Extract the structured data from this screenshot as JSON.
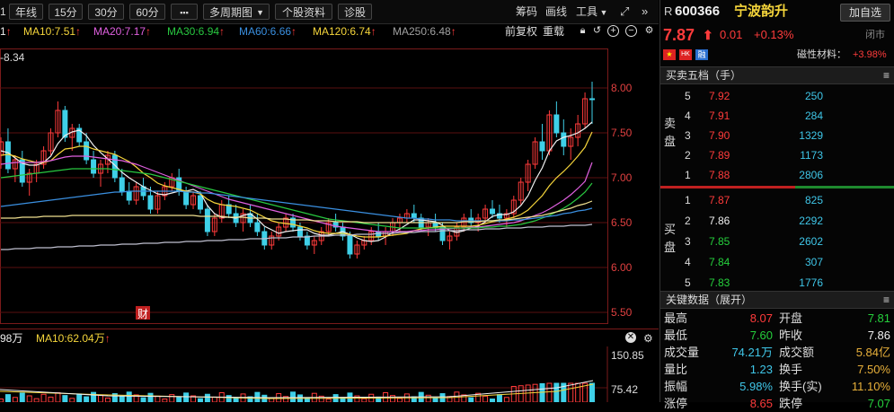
{
  "toolbar": {
    "first": "1",
    "year_line": "年线",
    "min15": "15分",
    "min30": "30分",
    "min60": "60分",
    "more": "▪▪▪",
    "multi_period": "多周期图",
    "stock_info": "个股资料",
    "diagnose": "诊股",
    "chips": "筹码",
    "draw_line": "画线",
    "tools": "工具"
  },
  "ma": {
    "ma5": "1",
    "ma10": "MA10:7.51",
    "ma20": "MA20:7.17",
    "ma30": "MA30:6.94",
    "ma60": "MA60:6.66",
    "ma120": "MA120:6.74",
    "ma250": "MA250:6.48",
    "arrow": "↑",
    "adjust": "前复权",
    "overlay": "重载"
  },
  "chart_data": {
    "type": "candlestick",
    "yticks": [
      "8.00",
      "7.50",
      "7.00",
      "6.50",
      "6.00",
      "5.50"
    ],
    "ylim": [
      5.5,
      8.34
    ],
    "top_label": "8.34",
    "annotation": "财",
    "candles": [
      [
        7.25,
        7.45,
        7.1,
        7.4
      ],
      [
        7.4,
        7.55,
        7.05,
        7.1
      ],
      [
        7.1,
        7.25,
        6.95,
        7.2
      ],
      [
        7.2,
        7.3,
        6.9,
        6.95
      ],
      [
        6.95,
        7.1,
        6.8,
        7.05
      ],
      [
        7.05,
        7.2,
        6.95,
        7.15
      ],
      [
        7.15,
        7.35,
        7.1,
        7.3
      ],
      [
        7.3,
        7.55,
        7.25,
        7.5
      ],
      [
        7.5,
        7.85,
        7.45,
        7.75
      ],
      [
        7.75,
        7.8,
        7.4,
        7.45
      ],
      [
        7.45,
        7.6,
        7.3,
        7.55
      ],
      [
        7.55,
        7.6,
        7.35,
        7.4
      ],
      [
        7.4,
        7.5,
        7.15,
        7.2
      ],
      [
        7.2,
        7.3,
        7.0,
        7.05
      ],
      [
        7.05,
        7.2,
        6.9,
        7.15
      ],
      [
        7.15,
        7.3,
        7.05,
        7.25
      ],
      [
        7.25,
        7.3,
        6.95,
        7.0
      ],
      [
        7.0,
        7.1,
        6.8,
        6.85
      ],
      [
        6.85,
        6.95,
        6.7,
        6.75
      ],
      [
        6.75,
        6.95,
        6.7,
        6.9
      ],
      [
        6.9,
        7.0,
        6.75,
        6.8
      ],
      [
        6.8,
        6.9,
        6.6,
        6.65
      ],
      [
        6.65,
        6.85,
        6.6,
        6.8
      ],
      [
        6.8,
        6.95,
        6.75,
        6.9
      ],
      [
        6.9,
        7.05,
        6.85,
        7.0
      ],
      [
        7.0,
        7.1,
        6.8,
        6.85
      ],
      [
        6.85,
        6.9,
        6.65,
        6.7
      ],
      [
        6.7,
        6.85,
        6.65,
        6.8
      ],
      [
        6.8,
        6.85,
        6.6,
        6.65
      ],
      [
        6.65,
        6.7,
        6.35,
        6.4
      ],
      [
        6.4,
        6.6,
        6.35,
        6.55
      ],
      [
        6.55,
        6.75,
        6.5,
        6.7
      ],
      [
        6.7,
        6.8,
        6.55,
        6.6
      ],
      [
        6.6,
        6.7,
        6.45,
        6.5
      ],
      [
        6.5,
        6.65,
        6.4,
        6.6
      ],
      [
        6.6,
        6.7,
        6.45,
        6.5
      ],
      [
        6.5,
        6.6,
        6.35,
        6.4
      ],
      [
        6.4,
        6.45,
        6.2,
        6.25
      ],
      [
        6.25,
        6.4,
        6.2,
        6.35
      ],
      [
        6.35,
        6.5,
        6.3,
        6.45
      ],
      [
        6.45,
        6.6,
        6.4,
        6.55
      ],
      [
        6.55,
        6.6,
        6.4,
        6.45
      ],
      [
        6.45,
        6.5,
        6.3,
        6.35
      ],
      [
        6.35,
        6.4,
        6.2,
        6.25
      ],
      [
        6.25,
        6.35,
        6.15,
        6.3
      ],
      [
        6.3,
        6.45,
        6.25,
        6.4
      ],
      [
        6.4,
        6.55,
        6.35,
        6.5
      ],
      [
        6.5,
        6.6,
        6.4,
        6.45
      ],
      [
        6.45,
        6.5,
        6.3,
        6.35
      ],
      [
        6.35,
        6.4,
        6.1,
        6.15
      ],
      [
        6.15,
        6.3,
        6.1,
        6.25
      ],
      [
        6.25,
        6.35,
        6.2,
        6.3
      ],
      [
        6.3,
        6.45,
        6.25,
        6.4
      ],
      [
        6.4,
        6.5,
        6.3,
        6.35
      ],
      [
        6.35,
        6.45,
        6.25,
        6.4
      ],
      [
        6.4,
        6.55,
        6.35,
        6.5
      ],
      [
        6.5,
        6.6,
        6.4,
        6.55
      ],
      [
        6.55,
        6.65,
        6.5,
        6.6
      ],
      [
        6.6,
        6.7,
        6.5,
        6.55
      ],
      [
        6.55,
        6.6,
        6.4,
        6.45
      ],
      [
        6.45,
        6.55,
        6.35,
        6.5
      ],
      [
        6.5,
        6.6,
        6.4,
        6.45
      ],
      [
        6.45,
        6.5,
        6.25,
        6.3
      ],
      [
        6.3,
        6.4,
        6.2,
        6.35
      ],
      [
        6.35,
        6.5,
        6.3,
        6.45
      ],
      [
        6.45,
        6.6,
        6.4,
        6.55
      ],
      [
        6.55,
        6.65,
        6.45,
        6.5
      ],
      [
        6.5,
        6.6,
        6.4,
        6.55
      ],
      [
        6.55,
        6.7,
        6.5,
        6.65
      ],
      [
        6.65,
        6.75,
        6.55,
        6.6
      ],
      [
        6.6,
        6.7,
        6.5,
        6.55
      ],
      [
        6.55,
        6.65,
        6.45,
        6.6
      ],
      [
        6.6,
        6.8,
        6.55,
        6.75
      ],
      [
        6.75,
        7.0,
        6.7,
        6.95
      ],
      [
        6.95,
        7.2,
        6.85,
        7.15
      ],
      [
        7.15,
        7.45,
        7.1,
        7.4
      ],
      [
        7.4,
        7.6,
        7.2,
        7.3
      ],
      [
        7.3,
        7.75,
        7.25,
        7.7
      ],
      [
        7.7,
        7.85,
        7.45,
        7.5
      ],
      [
        7.5,
        7.65,
        7.25,
        7.35
      ],
      [
        7.35,
        7.55,
        7.2,
        7.45
      ],
      [
        7.45,
        7.7,
        7.35,
        7.6
      ],
      [
        7.6,
        7.95,
        7.55,
        7.88
      ],
      [
        7.88,
        8.07,
        7.6,
        7.87
      ]
    ],
    "mas": [
      {
        "name": "MA5",
        "color": "#f0f0f0",
        "values": [
          7.3,
          7.28,
          7.22,
          7.16,
          7.14,
          7.14,
          7.17,
          7.24,
          7.38,
          7.47,
          7.51,
          7.53,
          7.47,
          7.36,
          7.28,
          7.21,
          7.14,
          7.06,
          7.0,
          6.95,
          6.9,
          6.86,
          6.82,
          6.81,
          6.83,
          6.85,
          6.85,
          6.87,
          6.83,
          6.69,
          6.6,
          6.56,
          6.56,
          6.55,
          6.58,
          6.6,
          6.54,
          6.46,
          6.42,
          6.38,
          6.4,
          6.41,
          6.42,
          6.42,
          6.38,
          6.36,
          6.36,
          6.38,
          6.4,
          6.37,
          6.33,
          6.3,
          6.29,
          6.3,
          6.34,
          6.39,
          6.43,
          6.48,
          6.53,
          6.53,
          6.52,
          6.51,
          6.47,
          6.41,
          6.39,
          6.41,
          6.44,
          6.46,
          6.51,
          6.57,
          6.59,
          6.59,
          6.62,
          6.69,
          6.8,
          6.97,
          7.11,
          7.3,
          7.41,
          7.45,
          7.47,
          7.5,
          7.55,
          7.62
        ]
      },
      {
        "name": "MA10",
        "color": "#f5d53b",
        "values": [
          7.25,
          7.26,
          7.24,
          7.21,
          7.19,
          7.17,
          7.17,
          7.19,
          7.26,
          7.32,
          7.33,
          7.35,
          7.35,
          7.32,
          7.3,
          7.28,
          7.26,
          7.22,
          7.18,
          7.12,
          7.05,
          7.0,
          6.94,
          6.91,
          6.89,
          6.87,
          6.85,
          6.84,
          6.82,
          6.76,
          6.72,
          6.7,
          6.69,
          6.68,
          6.66,
          6.64,
          6.6,
          6.56,
          6.52,
          6.5,
          6.49,
          6.48,
          6.46,
          6.44,
          6.41,
          6.39,
          6.38,
          6.38,
          6.38,
          6.37,
          6.35,
          6.34,
          6.34,
          6.34,
          6.35,
          6.36,
          6.37,
          6.38,
          6.41,
          6.43,
          6.44,
          6.45,
          6.46,
          6.46,
          6.46,
          6.46,
          6.46,
          6.47,
          6.49,
          6.51,
          6.52,
          6.54,
          6.56,
          6.59,
          6.64,
          6.72,
          6.8,
          6.91,
          7.0,
          7.07,
          7.15,
          7.24,
          7.34,
          7.51
        ]
      },
      {
        "name": "MA20",
        "color": "#e060e0",
        "values": [
          7.15,
          7.16,
          7.17,
          7.17,
          7.17,
          7.17,
          7.18,
          7.19,
          7.21,
          7.23,
          7.24,
          7.24,
          7.24,
          7.23,
          7.22,
          7.21,
          7.2,
          7.19,
          7.17,
          7.15,
          7.12,
          7.09,
          7.06,
          7.03,
          7.0,
          6.97,
          6.94,
          6.91,
          6.88,
          6.85,
          6.82,
          6.79,
          6.76,
          6.74,
          6.72,
          6.7,
          6.68,
          6.66,
          6.64,
          6.62,
          6.6,
          6.58,
          6.56,
          6.54,
          6.52,
          6.5,
          6.48,
          6.46,
          6.45,
          6.44,
          6.43,
          6.42,
          6.41,
          6.4,
          6.4,
          6.4,
          6.4,
          6.4,
          6.41,
          6.41,
          6.42,
          6.42,
          6.43,
          6.43,
          6.44,
          6.44,
          6.45,
          6.45,
          6.46,
          6.47,
          6.48,
          6.49,
          6.5,
          6.52,
          6.55,
          6.58,
          6.61,
          6.65,
          6.7,
          6.75,
          6.81,
          6.88,
          6.96,
          7.17
        ]
      },
      {
        "name": "MA30",
        "color": "#28c840",
        "values": [
          7.0,
          7.01,
          7.02,
          7.03,
          7.04,
          7.05,
          7.06,
          7.07,
          7.08,
          7.09,
          7.1,
          7.1,
          7.1,
          7.1,
          7.1,
          7.1,
          7.09,
          7.08,
          7.07,
          7.06,
          7.05,
          7.04,
          7.02,
          7.0,
          6.98,
          6.96,
          6.94,
          6.92,
          6.9,
          6.88,
          6.86,
          6.84,
          6.82,
          6.8,
          6.78,
          6.76,
          6.74,
          6.72,
          6.7,
          6.68,
          6.66,
          6.64,
          6.62,
          6.6,
          6.58,
          6.56,
          6.54,
          6.53,
          6.52,
          6.51,
          6.5,
          6.49,
          6.48,
          6.47,
          6.46,
          6.45,
          6.44,
          6.44,
          6.44,
          6.44,
          6.44,
          6.44,
          6.44,
          6.44,
          6.44,
          6.44,
          6.44,
          6.44,
          6.45,
          6.45,
          6.46,
          6.46,
          6.47,
          6.48,
          6.5,
          6.52,
          6.55,
          6.58,
          6.62,
          6.66,
          6.71,
          6.77,
          6.84,
          6.94
        ]
      },
      {
        "name": "MA60",
        "color": "#3a8fe0",
        "values": [
          6.68,
          6.69,
          6.7,
          6.71,
          6.72,
          6.73,
          6.74,
          6.75,
          6.76,
          6.77,
          6.78,
          6.79,
          6.8,
          6.81,
          6.82,
          6.83,
          6.84,
          6.84,
          6.85,
          6.85,
          6.85,
          6.85,
          6.85,
          6.85,
          6.85,
          6.85,
          6.84,
          6.84,
          6.83,
          6.83,
          6.82,
          6.81,
          6.8,
          6.79,
          6.78,
          6.77,
          6.76,
          6.75,
          6.74,
          6.73,
          6.72,
          6.71,
          6.7,
          6.69,
          6.68,
          6.67,
          6.66,
          6.65,
          6.64,
          6.63,
          6.62,
          6.61,
          6.6,
          6.59,
          6.58,
          6.57,
          6.56,
          6.55,
          6.55,
          6.54,
          6.54,
          6.53,
          6.53,
          6.53,
          6.52,
          6.52,
          6.52,
          6.52,
          6.52,
          6.52,
          6.52,
          6.52,
          6.53,
          6.53,
          6.54,
          6.55,
          6.56,
          6.57,
          6.58,
          6.6,
          6.61,
          6.63,
          6.64,
          6.66
        ]
      },
      {
        "name": "MA120",
        "color": "#f0e090",
        "values": [
          6.55,
          6.55,
          6.55,
          6.56,
          6.56,
          6.56,
          6.57,
          6.57,
          6.57,
          6.57,
          6.58,
          6.58,
          6.58,
          6.58,
          6.58,
          6.58,
          6.58,
          6.58,
          6.58,
          6.58,
          6.58,
          6.58,
          6.58,
          6.58,
          6.58,
          6.58,
          6.58,
          6.58,
          6.57,
          6.57,
          6.57,
          6.57,
          6.56,
          6.56,
          6.56,
          6.55,
          6.55,
          6.55,
          6.54,
          6.54,
          6.54,
          6.53,
          6.53,
          6.53,
          6.52,
          6.52,
          6.52,
          6.51,
          6.51,
          6.51,
          6.51,
          6.5,
          6.5,
          6.5,
          6.5,
          6.5,
          6.5,
          6.5,
          6.5,
          6.5,
          6.5,
          6.5,
          6.5,
          6.5,
          6.5,
          6.51,
          6.51,
          6.51,
          6.52,
          6.52,
          6.53,
          6.53,
          6.54,
          6.55,
          6.56,
          6.57,
          6.58,
          6.6,
          6.62,
          6.64,
          6.66,
          6.69,
          6.71,
          6.74
        ]
      },
      {
        "name": "MA250",
        "color": "#c0c0d0",
        "values": [
          6.2,
          6.2,
          6.21,
          6.21,
          6.21,
          6.22,
          6.22,
          6.22,
          6.23,
          6.23,
          6.23,
          6.24,
          6.24,
          6.24,
          6.25,
          6.25,
          6.25,
          6.26,
          6.26,
          6.26,
          6.27,
          6.27,
          6.27,
          6.28,
          6.28,
          6.28,
          6.29,
          6.29,
          6.29,
          6.3,
          6.3,
          6.3,
          6.31,
          6.31,
          6.31,
          6.32,
          6.32,
          6.32,
          6.33,
          6.33,
          6.33,
          6.34,
          6.34,
          6.34,
          6.35,
          6.35,
          6.35,
          6.36,
          6.36,
          6.36,
          6.37,
          6.37,
          6.37,
          6.38,
          6.38,
          6.38,
          6.39,
          6.39,
          6.39,
          6.4,
          6.4,
          6.4,
          6.41,
          6.41,
          6.41,
          6.42,
          6.42,
          6.42,
          6.43,
          6.43,
          6.43,
          6.44,
          6.44,
          6.44,
          6.45,
          6.45,
          6.45,
          6.46,
          6.46,
          6.46,
          6.47,
          6.47,
          6.47,
          6.48
        ]
      }
    ],
    "volume_ticks": [
      "150.85",
      "75.42"
    ]
  },
  "sub": {
    "vol_ma5": "98万",
    "vol_ma10": "MA10:62.04万"
  },
  "stock": {
    "prefix": "R",
    "code": "600366",
    "name": "宁波韵升",
    "add_button": "加自选",
    "price": "7.87",
    "change": "0.01",
    "change_pct": "+0.13%",
    "status": "闭市",
    "concept": "磁性材料：",
    "concept_pct": "+3.98%",
    "tags": [
      "",
      "HK",
      "融"
    ]
  },
  "orderbook": {
    "title": "买卖五档（手）",
    "sell_label": "卖盘",
    "buy_label": "买盘",
    "sell": [
      {
        "lvl": "5",
        "price": "7.92",
        "vol": "250"
      },
      {
        "lvl": "4",
        "price": "7.91",
        "vol": "284"
      },
      {
        "lvl": "3",
        "price": "7.90",
        "vol": "1329"
      },
      {
        "lvl": "2",
        "price": "7.89",
        "vol": "1173"
      },
      {
        "lvl": "1",
        "price": "7.88",
        "vol": "2806"
      }
    ],
    "buy": [
      {
        "lvl": "1",
        "price": "7.87",
        "vol": "825"
      },
      {
        "lvl": "2",
        "price": "7.86",
        "vol": "2292"
      },
      {
        "lvl": "3",
        "price": "7.85",
        "vol": "2602"
      },
      {
        "lvl": "4",
        "price": "7.84",
        "vol": "307"
      },
      {
        "lvl": "5",
        "price": "7.83",
        "vol": "1776"
      }
    ]
  },
  "keydata": {
    "title": "关键数据（展开）",
    "rows": [
      {
        "l1": "最高",
        "v1": "8.07",
        "l2": "开盘",
        "v2": "7.81"
      },
      {
        "l1": "最低",
        "v1": "7.60",
        "l2": "昨收",
        "v2": "7.86"
      },
      {
        "l1": "成交量",
        "v1": "74.21万",
        "l2": "成交额",
        "v2": "5.84亿"
      },
      {
        "l1": "量比",
        "v1": "1.23",
        "l2": "换手",
        "v2": "7.50%"
      },
      {
        "l1": "振幅",
        "v1": "5.98%",
        "l2": "换手(实)",
        "v2": "11.10%"
      },
      {
        "l1": "涨停",
        "v1": "8.65",
        "l2": "跌停",
        "v2": "7.07"
      }
    ]
  }
}
